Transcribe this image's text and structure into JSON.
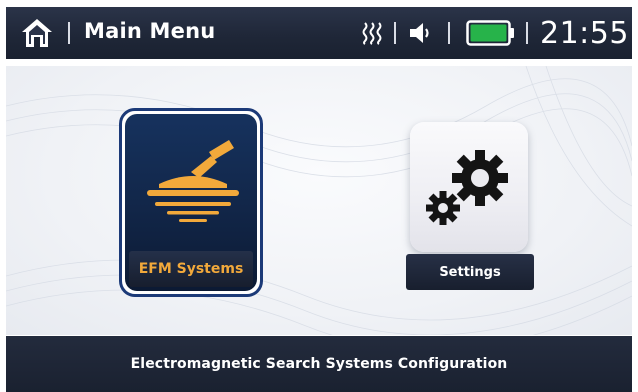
{
  "header": {
    "title": "Main Menu",
    "time": "21:55",
    "icons": [
      "home-icon",
      "heating-icon",
      "speaker-icon",
      "battery-icon"
    ],
    "battery_color": "#27b34a"
  },
  "menu": {
    "items": [
      {
        "label": "EFM Systems",
        "icon": "metal-detector-icon",
        "selected": true,
        "label_color": "#f2a93b"
      },
      {
        "label": "Settings",
        "icon": "gears-icon",
        "selected": false,
        "label_color": "#ffffff"
      }
    ]
  },
  "footer": {
    "description": "Electromagnetic Search Systems Configuration"
  },
  "colors": {
    "bar_background": "#1f2738",
    "accent_orange": "#f2a93b",
    "selection_border": "#1c3a78"
  }
}
